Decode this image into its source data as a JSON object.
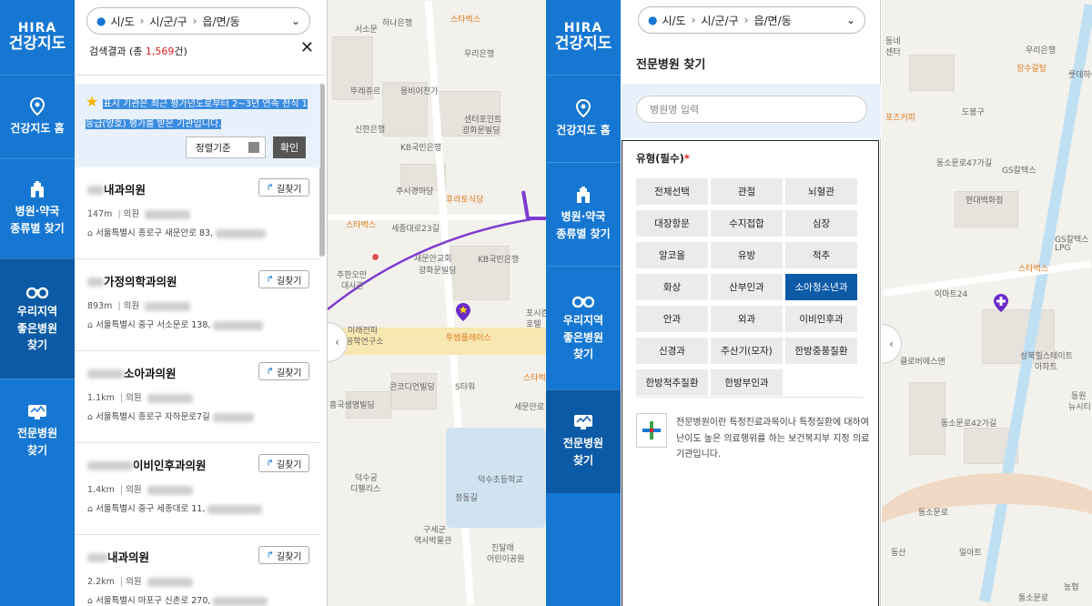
{
  "brand": {
    "line1": "HIRA",
    "line2": "건강지도"
  },
  "nav": [
    {
      "label1": "건강지도 홈",
      "label2": ""
    },
    {
      "label1": "병원·약국",
      "label2": "종류별 찾기"
    },
    {
      "label1": "우리지역",
      "label2": "좋은병원",
      "label3": "찾기"
    },
    {
      "label1": "전문병원",
      "label2": "찾기"
    }
  ],
  "region": {
    "a": "시/도",
    "b": "시/군/구",
    "c": "읍/면/동"
  },
  "results": {
    "label": "검색결과 (총 ",
    "count": "1,569",
    "suffix": "건)"
  },
  "notice": {
    "star": "★",
    "text": "표시 기관은 최근 평가년도로부터 2~3년 연속 천식 1등급(양호) 평가를 받은 기관입니다."
  },
  "sort": {
    "label": "정렬기준",
    "confirm": "확인"
  },
  "hospitals": [
    {
      "name": "내과의원",
      "dist": "147m",
      "type": "의원",
      "addr": "서울특별시 종로구 새문안로 83,"
    },
    {
      "name": "가정의학과의원",
      "dist": "893m",
      "type": "의원",
      "addr": "서울특별시 중구 서소문로 138,"
    },
    {
      "name": "소아과의원",
      "dist": "1.1km",
      "type": "의원",
      "addr": "서울특별시 종로구 자하문로7길"
    },
    {
      "name": "이비인후과의원",
      "dist": "1.4km",
      "type": "의원",
      "addr": "서울특별시 중구 세종대로 11,"
    },
    {
      "name": "내과의원",
      "dist": "2.2km",
      "type": "의원",
      "addr": "서울특별시 마포구 신촌로 270,"
    }
  ],
  "route_label": "길찾기",
  "map_left": [
    "하나은행",
    "스타벅스",
    "우리은행",
    "뚜레쥬르",
    "용비어천가",
    "신한은행",
    "센터포인트",
    "광화문빌딩",
    "KB국민은행",
    "주시경마당",
    "후라토식당",
    "스타벅스",
    "세종대로23길",
    "새문안교회",
    "KB국민은행",
    "광화문빌딩",
    "주한오만",
    "대사관",
    "미래전파",
    "공학연구소",
    "투썸플레이스",
    "포시즌",
    "호텔",
    "스타벅스",
    "콘코디언빌딩",
    "S타워",
    "흥국생명빌딩",
    "덕수초등학교",
    "덕수궁",
    "디팰리스",
    "구세군",
    "역사박물관",
    "정동길",
    "세문안로",
    "진달래",
    "어린이공원",
    "서소문"
  ],
  "specialty": {
    "title": "전문병원 찾기",
    "placeholder": "병원명 입력",
    "type_label": "유형(필수)",
    "required_mark": "*",
    "types": [
      "전체선택",
      "관절",
      "뇌혈관",
      "대장항문",
      "수지접합",
      "심장",
      "알코올",
      "유방",
      "척추",
      "화상",
      "산부인과",
      "소아청소년과",
      "안과",
      "외과",
      "이비인후과",
      "신경과",
      "주산기(모자)",
      "한방중풍질환",
      "한방척추질환",
      "한방부인과"
    ],
    "selected": "소아청소년과",
    "info": "전문병원이란 특정진료과목이나 특정질환에 대하여 난이도 높은 의료행위를 하는 보건복지부 지정 의료 기관입니다."
  },
  "map_right": [
    "동네",
    "센터",
    "우리은행",
    "장수갈탕",
    "포즈커피",
    "도봉구",
    "룻데하이",
    "GS칼텍스",
    "현대백화점",
    "GS칼텍스",
    "LPG",
    "이마트24",
    "스타벅스",
    "성북힐스테이트",
    "아파트",
    "클로버에스앤",
    "동소문로47가길",
    "동소문로42가길",
    "동원",
    "뉴시티",
    "일아트",
    "동소문로",
    "동산",
    "농협",
    "통소문로"
  ],
  "colors": {
    "brand": "#1677d3",
    "active": "#0c5aa6",
    "accent": "#e02020",
    "highlight": "#3b8ce0",
    "purple": "#6a2bc7"
  }
}
